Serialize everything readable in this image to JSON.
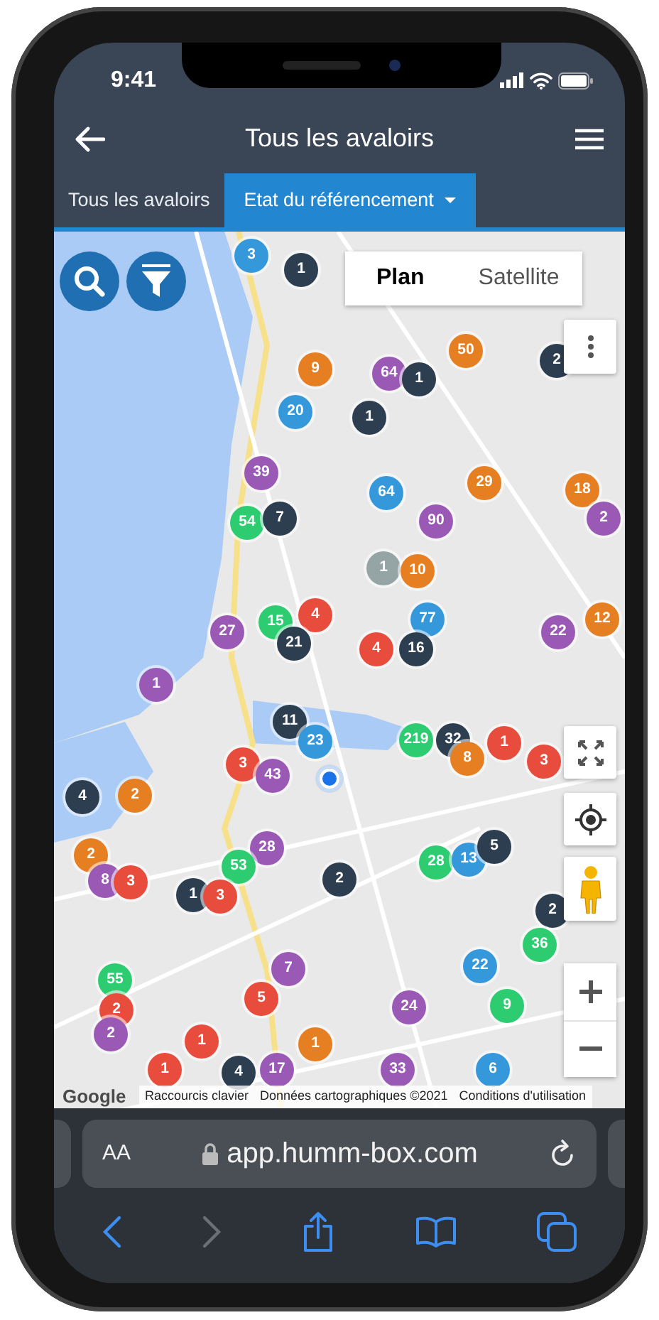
{
  "status_bar": {
    "time": "9:41"
  },
  "app_bar": {
    "title": "Tous les avaloirs"
  },
  "tabs": [
    {
      "label": "Tous les avaloirs",
      "selected": false,
      "dropdown": false
    },
    {
      "label": "Etat du référencement",
      "selected": true,
      "dropdown": true
    }
  ],
  "map": {
    "map_types": [
      {
        "label": "Plan",
        "selected": true
      },
      {
        "label": "Satellite",
        "selected": false
      }
    ],
    "clusters": [
      {
        "count": "3",
        "color": "#3498db"
      },
      {
        "count": "1",
        "color": "#2c3e50"
      },
      {
        "count": "9",
        "color": "#e67e22"
      },
      {
        "count": "20",
        "color": "#3498db"
      },
      {
        "count": "39",
        "color": "#9b59b6"
      },
      {
        "count": "54",
        "color": "#2ecc71"
      },
      {
        "count": "7",
        "color": "#2c3e50"
      },
      {
        "count": "27",
        "color": "#9b59b6"
      },
      {
        "count": "15",
        "color": "#2ecc71"
      },
      {
        "count": "4",
        "color": "#e74c3c"
      },
      {
        "count": "21",
        "color": "#2c3e50"
      },
      {
        "count": "1",
        "color": "#9b59b6"
      },
      {
        "count": "50",
        "color": "#e67e22"
      },
      {
        "count": "2",
        "color": "#2c3e50"
      },
      {
        "count": "64",
        "color": "#9b59b6"
      },
      {
        "count": "1",
        "color": "#2c3e50"
      },
      {
        "count": "1",
        "color": "#2c3e50"
      },
      {
        "count": "64",
        "color": "#3498db"
      },
      {
        "count": "29",
        "color": "#e67e22"
      },
      {
        "count": "18",
        "color": "#e67e22"
      },
      {
        "count": "90",
        "color": "#9b59b6"
      },
      {
        "count": "2",
        "color": "#9b59b6"
      },
      {
        "count": "1",
        "color": "#95a5a6"
      },
      {
        "count": "10",
        "color": "#e67e22"
      },
      {
        "count": "77",
        "color": "#3498db"
      },
      {
        "count": "22",
        "color": "#9b59b6"
      },
      {
        "count": "12",
        "color": "#e67e22"
      },
      {
        "count": "4",
        "color": "#e74c3c"
      },
      {
        "count": "16",
        "color": "#2c3e50"
      },
      {
        "count": "11",
        "color": "#2c3e50"
      },
      {
        "count": "23",
        "color": "#3498db"
      },
      {
        "count": "3",
        "color": "#e74c3c"
      },
      {
        "count": "43",
        "color": "#9b59b6"
      },
      {
        "count": "4",
        "color": "#2c3e50"
      },
      {
        "count": "2",
        "color": "#e67e22"
      },
      {
        "count": "2",
        "color": "#e67e22"
      },
      {
        "count": "8",
        "color": "#9b59b6"
      },
      {
        "count": "3",
        "color": "#e74c3c"
      },
      {
        "count": "28",
        "color": "#9b59b6"
      },
      {
        "count": "53",
        "color": "#2ecc71"
      },
      {
        "count": "1",
        "color": "#2c3e50"
      },
      {
        "count": "3",
        "color": "#e74c3c"
      },
      {
        "count": "2",
        "color": "#2c3e50"
      },
      {
        "count": "55",
        "color": "#2ecc71"
      },
      {
        "count": "2",
        "color": "#e74c3c"
      },
      {
        "count": "7",
        "color": "#9b59b6"
      },
      {
        "count": "5",
        "color": "#e74c3c"
      },
      {
        "count": "1",
        "color": "#e74c3c"
      },
      {
        "count": "1",
        "color": "#e74c3c"
      },
      {
        "count": "1",
        "color": "#e67e22"
      },
      {
        "count": "2",
        "color": "#9b59b6"
      },
      {
        "count": "4",
        "color": "#2c3e50"
      },
      {
        "count": "17",
        "color": "#9b59b6"
      },
      {
        "count": "219",
        "color": "#2ecc71"
      },
      {
        "count": "32",
        "color": "#2c3e50"
      },
      {
        "count": "8",
        "color": "#e67e22"
      },
      {
        "count": "1",
        "color": "#e74c3c"
      },
      {
        "count": "3",
        "color": "#e74c3c"
      },
      {
        "count": "28",
        "color": "#2ecc71"
      },
      {
        "count": "13",
        "color": "#3498db"
      },
      {
        "count": "5",
        "color": "#2c3e50"
      },
      {
        "count": "2",
        "color": "#2c3e50"
      },
      {
        "count": "22",
        "color": "#3498db"
      },
      {
        "count": "24",
        "color": "#9b59b6"
      },
      {
        "count": "9",
        "color": "#2ecc71"
      },
      {
        "count": "33",
        "color": "#9b59b6"
      },
      {
        "count": "6",
        "color": "#3498db"
      },
      {
        "count": "36",
        "color": "#2ecc71"
      }
    ],
    "logo": "Google",
    "attribution": [
      "Raccourcis clavier",
      "Données cartographiques ©2021",
      "Conditions d'utilisation"
    ]
  },
  "browser": {
    "text_size": "AA",
    "url": "app.humm-box.com",
    "back_enabled": true,
    "forward_enabled": false
  }
}
